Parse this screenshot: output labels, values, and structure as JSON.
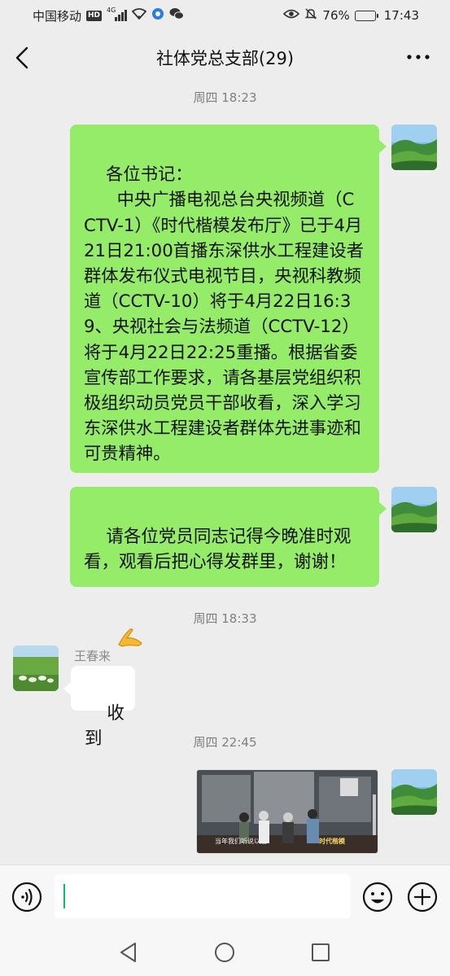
{
  "status_bar": {
    "carrier": "中国移动",
    "hd": "HD",
    "network": "4G",
    "battery_percent": "76%",
    "battery_level": 0.76,
    "time": "17:43"
  },
  "nav": {
    "title": "社体党总支部(29)",
    "back_icon": "chevron-left-icon",
    "more_icon": "more-dots-icon"
  },
  "messages": {
    "time1": "周四 18:23",
    "msg1": "各位书记：\n      中央广播电视总台央视频道（CCTV-1）《时代楷模发布厅》已于4月21日21:00首播东深供水工程建设者群体发布仪式电视节目，央视科教频道（CCTV-10）将于4月22日16:39、央视社会与法频道（CCTV-12）将于4月22日22:25重播。根据省委宣传部工作要求，请各基层党组织积极组织动员党员干部收看，深入学习东深供水工程建设者群体先进事迹和可贵精神。",
    "msg2": "请各位党员同志记得今晚准时观看，观看后把心得发群里，谢谢！",
    "msg2_emoji": "praying-hands-emoji",
    "time2": "周四 18:33",
    "sender": "王春来",
    "msg3": "收到",
    "time3": "周四 22:45",
    "video_caption": "当年我们听说以后",
    "video_brand": "时代楷模"
  },
  "input_bar": {
    "voice_icon": "voice-icon",
    "emoji_icon": "emoji-icon",
    "add_icon": "plus-icon",
    "value": ""
  },
  "colors": {
    "accent_green": "#07c160",
    "bubble_me": "#95ec69",
    "bubble_other": "#ffffff",
    "background": "#ededed"
  }
}
